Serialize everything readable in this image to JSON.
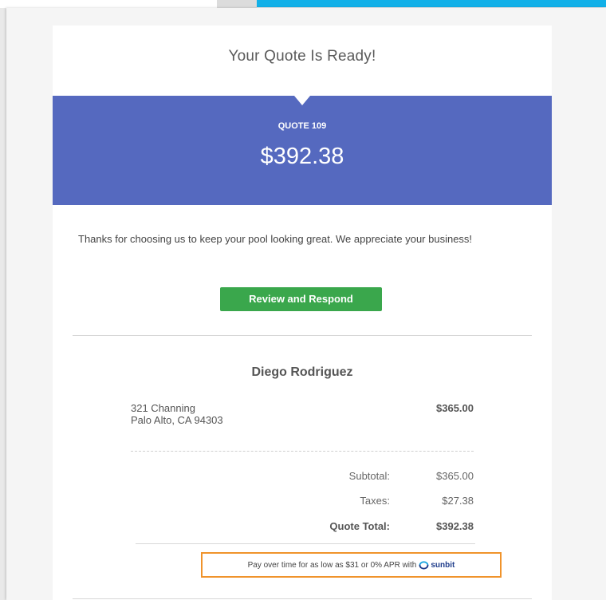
{
  "email": {
    "headline": "Your Quote Is Ready!",
    "quote_number": "QUOTE 109",
    "quote_amount": "$392.38",
    "thanks_message": "Thanks for choosing us to keep your pool looking great. We appreciate your business!",
    "cta_label": "Review and Respond"
  },
  "customer": {
    "name": "Diego Rodriguez",
    "address_line1": "321 Channing",
    "address_line2": "Palo Alto, CA 94303",
    "line_amount": "$365.00"
  },
  "totals": {
    "subtotal_label": "Subtotal:",
    "subtotal_value": "$365.00",
    "taxes_label": "Taxes:",
    "taxes_value": "$27.38",
    "total_label": "Quote Total:",
    "total_value": "$392.38"
  },
  "financing": {
    "text": "Pay over time for as low as $31 or 0% APR with",
    "brand": "sunbit",
    "brand_icon": "sunbit-logo-icon"
  },
  "colors": {
    "banner": "#5569bf",
    "cta": "#3aa74c",
    "highlight_border": "#f0932b",
    "top_accent": "#12b0e8"
  }
}
